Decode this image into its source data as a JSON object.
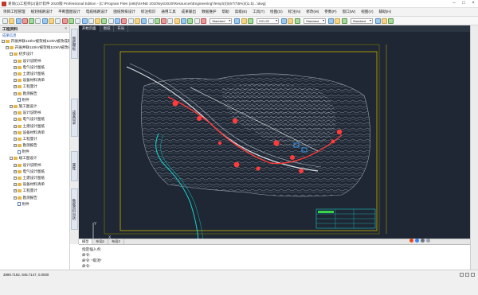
{
  "window": {
    "title": "易尚(1)工程师(2)设计软件 2020版 Professional Edition - [C:\\Program Files (x86)\\SHNE 2020\\sys\\2020\\Resources\\Engineering\\Temp\\(0)\\(67\\7\\5%)\\(i1.b)...\\dwg]"
  },
  "menu": [
    "项目工程管理",
    "规划线路设计",
    "平断面图设计",
    "电缆线路设计",
    "图纸预排设计",
    "标注标识",
    "通用工具",
    "成果输出",
    "数据维护",
    "帮助",
    "高级(B)",
    "工具(T)",
    "绘图(D)",
    "标注(N)",
    "修改(M)",
    "参数(P)",
    "窗口(W)",
    "视图(V)",
    "辅助(H)"
  ],
  "toolbar": {
    "layer_combo": "Standard",
    "linetype_combo": "ISO-25",
    "style_combo": "Standard",
    "dim_combo": "Standard"
  },
  "sidebar": {
    "title": "工程资料",
    "close": "×",
    "subheader": "成果信息",
    "tree": [
      {
        "level": 0,
        "icon": "folder",
        "toggle": "−",
        "label": "开展并联110kV被架线110kV被改成新建工程"
      },
      {
        "level": 1,
        "icon": "folder",
        "toggle": "−",
        "label": "开展并联110kV被架线110kV被改成新建工程"
      },
      {
        "level": 2,
        "icon": "folder",
        "toggle": "−",
        "label": "初步设计"
      },
      {
        "level": 3,
        "icon": "folder",
        "toggle": "+",
        "label": "设计说明书"
      },
      {
        "level": 3,
        "icon": "folder",
        "toggle": "+",
        "label": "电气设计图纸"
      },
      {
        "level": 3,
        "icon": "folder",
        "toggle": "+",
        "label": "土建设计图纸"
      },
      {
        "level": 3,
        "icon": "folder",
        "toggle": "+",
        "label": "设备材料清单"
      },
      {
        "level": 3,
        "icon": "folder",
        "toggle": "+",
        "label": "工程量计"
      },
      {
        "level": 3,
        "icon": "folder",
        "toggle": "+",
        "label": "勘测报告"
      },
      {
        "level": 3,
        "icon": "doc",
        "toggle": "",
        "label": "附件"
      },
      {
        "level": 2,
        "icon": "folder",
        "toggle": "−",
        "label": "施工图设计"
      },
      {
        "level": 3,
        "icon": "folder",
        "toggle": "+",
        "label": "设计说明书"
      },
      {
        "level": 3,
        "icon": "folder",
        "toggle": "+",
        "label": "电气设计图纸"
      },
      {
        "level": 3,
        "icon": "folder",
        "toggle": "+",
        "label": "土建设计图纸"
      },
      {
        "level": 3,
        "icon": "folder",
        "toggle": "+",
        "label": "设备材料清单"
      },
      {
        "level": 3,
        "icon": "folder",
        "toggle": "+",
        "label": "工程量计"
      },
      {
        "level": 3,
        "icon": "folder",
        "toggle": "+",
        "label": "勘测报告"
      },
      {
        "level": 3,
        "icon": "doc",
        "toggle": "",
        "label": "附件"
      },
      {
        "level": 2,
        "icon": "folder",
        "toggle": "−",
        "label": "竣工图设计"
      },
      {
        "level": 3,
        "icon": "folder",
        "toggle": "+",
        "label": "设计说明书"
      },
      {
        "level": 3,
        "icon": "folder",
        "toggle": "+",
        "label": "电气设计图纸"
      },
      {
        "level": 3,
        "icon": "folder",
        "toggle": "+",
        "label": "土建设计图纸"
      },
      {
        "level": 3,
        "icon": "folder",
        "toggle": "+",
        "label": "设备材料清单"
      },
      {
        "level": 3,
        "icon": "folder",
        "toggle": "+",
        "label": "工程量计"
      },
      {
        "level": 3,
        "icon": "folder",
        "toggle": "+",
        "label": "勘测报告"
      },
      {
        "level": 3,
        "icon": "doc",
        "toggle": "",
        "label": "附件"
      }
    ]
  },
  "vtabs": [
    "图纸模板",
    "成果目录",
    "属性",
    "数据资料包括"
  ],
  "canvas": {
    "tabs": [
      "开始页面",
      "图纸",
      "布局"
    ],
    "active_tab": 0,
    "bottom_tabs": [
      "模型",
      "布局1",
      "布局2"
    ],
    "active_bottom_tab": 0,
    "ucs_x": "X",
    "ucs_y": "Y"
  },
  "command_lines": [
    "指定插入点:",
    "命令:",
    "命令: *取消*",
    "命令:"
  ],
  "status": {
    "coords": "3899.7182, 846.7147, 0.0000"
  },
  "colors": {
    "canvas_bg": "#1e2733",
    "route": "#ff3b3b",
    "frame": "#c8b400",
    "river": "#19c7c7"
  }
}
